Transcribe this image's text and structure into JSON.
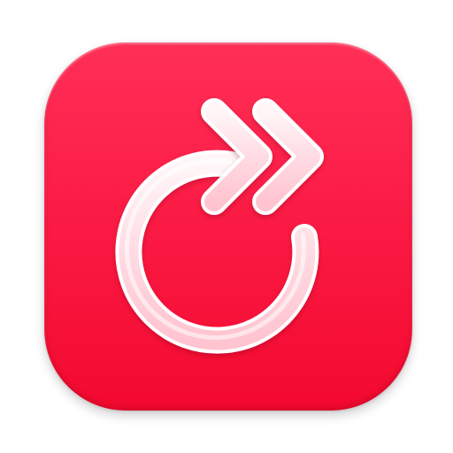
{
  "app_icon": {
    "name": "replay-forward-app-icon",
    "background_colors": [
      "#ff2f57",
      "#fb1c46",
      "#f3092f"
    ],
    "glyph_color": "#ffe8ee",
    "glyph_outline_color": "#ffffff",
    "icons": [
      "circular-arrow-icon",
      "double-chevron-right-icon"
    ]
  }
}
